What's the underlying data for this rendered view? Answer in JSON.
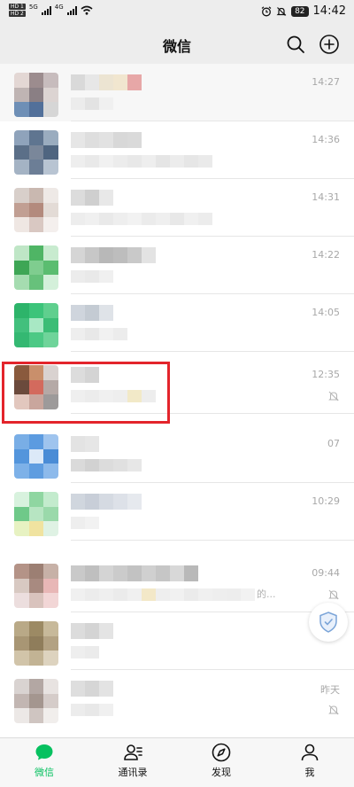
{
  "status_bar": {
    "sim1": "HD 1",
    "sim2": "HD 2",
    "net1": "5G",
    "net2": "4G",
    "battery": "82",
    "time": "14:42"
  },
  "header": {
    "title": "微信"
  },
  "chats": [
    {
      "time": "14:27",
      "muted": false
    },
    {
      "time": "14:36",
      "muted": false
    },
    {
      "time": "14:31",
      "muted": false
    },
    {
      "time": "14:22",
      "muted": false
    },
    {
      "time": "14:05",
      "muted": false
    },
    {
      "time": "12:35",
      "muted": true,
      "highlighted": true
    },
    {
      "time": "07",
      "muted": false
    },
    {
      "time": "10:29",
      "muted": false
    },
    {
      "time": "09:44",
      "muted": true,
      "preview_suffix": "的..."
    },
    {
      "time": "",
      "muted": false
    },
    {
      "time": "昨天",
      "muted": true
    }
  ],
  "tab_bar": {
    "tabs": [
      {
        "label": "微信",
        "icon": "chat-bubble-icon",
        "active": true
      },
      {
        "label": "通讯录",
        "icon": "contacts-icon",
        "active": false
      },
      {
        "label": "发现",
        "icon": "compass-icon",
        "active": false
      },
      {
        "label": "我",
        "icon": "person-icon",
        "active": false
      }
    ]
  },
  "colors": {
    "accent": "#07c160",
    "highlight": "#e3242b",
    "time_text": "#a8a8a8",
    "background": "#ededed"
  }
}
